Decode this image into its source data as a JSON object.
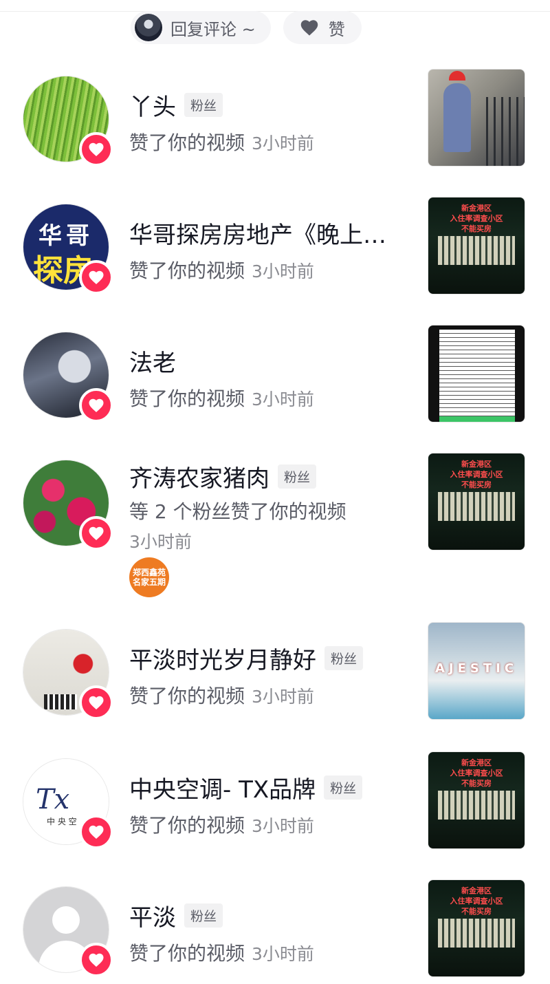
{
  "top_actions": {
    "reply_label": "回复评论 ~",
    "like_label": "赞"
  },
  "colors": {
    "accent": "#fe2c55",
    "text_primary": "#161823",
    "text_secondary": "#5a5c66"
  },
  "notifications": [
    {
      "name": "丫头",
      "tag": "粉丝",
      "action": "赞了你的视频",
      "time": "3小时前",
      "avatar_icon": "grass-avatar",
      "thumb_icon": "worker-thumbnail"
    },
    {
      "name": "华哥探房房地产《晚上…",
      "tag": "",
      "action": "赞了你的视频",
      "time": "3小时前",
      "avatar_icon": "brand-avatar",
      "avatar_text_top": "华哥",
      "avatar_text_bottom": "探房",
      "thumb_icon": "night-building-thumbnail",
      "thumb_caption": "新金港区\n入住率调查小区\n不能买房"
    },
    {
      "name": "法老",
      "tag": "",
      "action": "赞了你的视频",
      "time": "3小时前",
      "avatar_icon": "anime-avatar",
      "thumb_icon": "document-thumbnail"
    },
    {
      "name": "齐涛农家猪肉",
      "tag": "粉丝",
      "action": "等 2 个粉丝赞了你的视频",
      "time": "3小时前",
      "avatar_icon": "flower-avatar",
      "extra_avatar_text": "郑西鑫苑\n名家五期",
      "thumb_icon": "night-building-thumbnail",
      "thumb_caption": "新金港区\n入住率调查小区\n不能买房"
    },
    {
      "name": "平淡时光岁月静好",
      "tag": "粉丝",
      "action": "赞了你的视频",
      "time": "3小时前",
      "avatar_icon": "painting-avatar",
      "thumb_icon": "site-thumbnail",
      "thumb_caption": "AJESTIC"
    },
    {
      "name": "中央空调- TX品牌",
      "tag": "粉丝",
      "action": "赞了你的视频",
      "time": "3小时前",
      "avatar_icon": "tx-logo-avatar",
      "avatar_text_logo": "Tx",
      "avatar_text_cn": "中 央 空",
      "thumb_icon": "night-building-thumbnail",
      "thumb_caption": "新金港区\n入住率调查小区\n不能买房"
    },
    {
      "name": "平淡",
      "tag": "粉丝",
      "action": "赞了你的视频",
      "time": "3小时前",
      "avatar_icon": "default-avatar",
      "thumb_icon": "night-building-thumbnail",
      "thumb_caption": "新金港区\n入住率调查小区\n不能买房"
    }
  ]
}
